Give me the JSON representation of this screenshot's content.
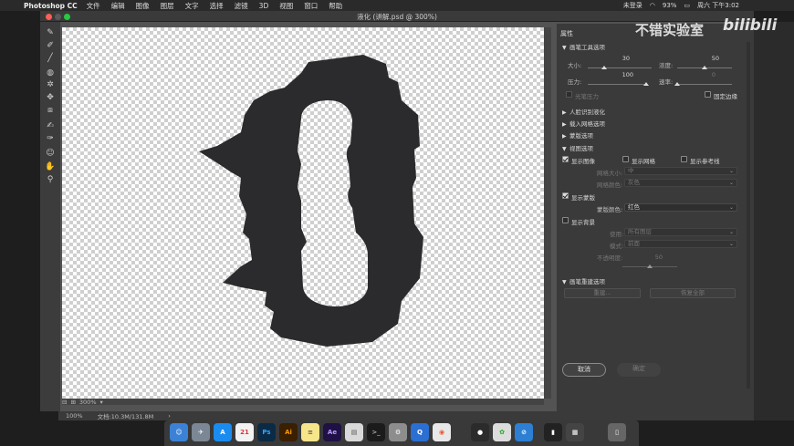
{
  "menubar": {
    "app_name": "Photoshop CC",
    "items": [
      "文件",
      "编辑",
      "图像",
      "图层",
      "文字",
      "选择",
      "滤镜",
      "3D",
      "视图",
      "窗口",
      "帮助"
    ],
    "status": {
      "login": "未登录",
      "battery": "93%",
      "clock": "周六 下午3:02"
    }
  },
  "window": {
    "title": "液化 (讲解.psd @ 300%)"
  },
  "tools": [
    "forward-warp-icon",
    "reconstruct-icon",
    "smooth-icon",
    "twirl-icon",
    "pucker-icon",
    "bloat-icon",
    "push-left-icon",
    "freeze-mask-icon",
    "thaw-mask-icon",
    "face-tool-icon",
    "hand-icon",
    "zoom-icon"
  ],
  "canvas": {
    "zoom": "300%",
    "fill_color": "#2b2b2e"
  },
  "properties": {
    "header": "属性",
    "brush_section": "画笔工具选项",
    "size_label": "大小:",
    "size_value": "30",
    "size_fraction": 0.25,
    "density_label": "浓度:",
    "density_value": "50",
    "density_fraction": 0.5,
    "pressure_label": "压力:",
    "pressure_value": "100",
    "pressure_fraction": 1.0,
    "rate_label": "速率:",
    "rate_value": "0",
    "rate_fraction": 0.0,
    "stylus_label": "光笔压力",
    "pin_edges_label": "固定边缘",
    "face_section": "人脸识别液化",
    "load_mesh_section": "载入网格选项",
    "mask_section": "蒙版选项",
    "view_section": "视图选项",
    "show_image": "显示图像",
    "show_mesh": "显示网格",
    "show_guides": "显示参考线",
    "mesh_size_label": "网格大小:",
    "mesh_size_value": "中",
    "mesh_color_label": "网格颜色:",
    "mesh_color_value": "灰色",
    "show_mask": "显示蒙版",
    "mask_color_label": "蒙版颜色:",
    "mask_color_value": "红色",
    "show_backdrop": "显示背景",
    "use_label": "使用:",
    "use_value": "所有图层",
    "mode_label": "模式:",
    "mode_value": "前面",
    "opacity_label": "不透明度:",
    "opacity_value": "50",
    "opacity_fraction": 0.5,
    "reconstruct_section": "画笔重建选项",
    "reconstruct_button": "重建...",
    "restore_all_button": "恢复全部",
    "cancel_button": "取消",
    "ok_button": "确定"
  },
  "ps_status": {
    "zoom": "100%",
    "doc_info": "文档:10.3M/131.8M"
  },
  "dock": [
    "finder-icon",
    "launchpad-icon",
    "appstore-icon",
    "calendar-icon",
    "photoshop-icon",
    "illustrator-icon",
    "notes-icon",
    "aftereffects-icon",
    "preview-icon",
    "terminal-icon",
    "system-prefs-icon",
    "quicktime-icon",
    "chrome-icon",
    "qq-icon",
    "wechat-icon",
    "safari-icon"
  ],
  "watermark": {
    "channel": "不错实验室",
    "site": "bilibili"
  }
}
